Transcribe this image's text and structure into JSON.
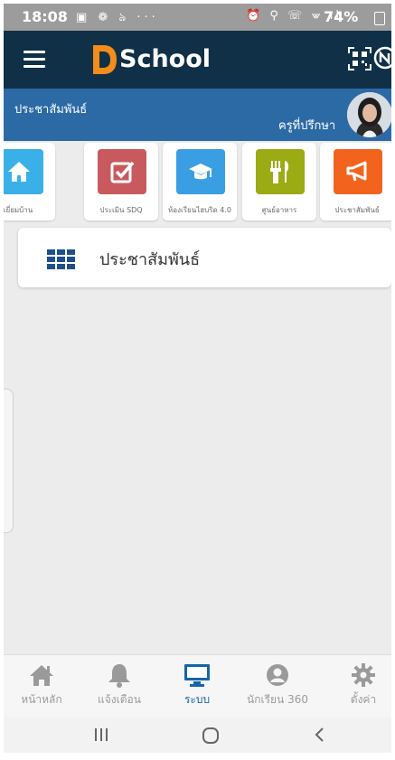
{
  "status_bar": {
    "time": "18:08",
    "left_icons": "▣ ❁ ঌ ···",
    "right_icons": "⏰ ⚲ ☏ ⩖ ıl",
    "battery_percent": "74%"
  },
  "app_bar": {
    "logo_letter": "D",
    "logo_text": "School",
    "menu_icon": "hamburger-icon",
    "qr_icon": "qr-scan-icon",
    "extra_icon": "circle-n-icon"
  },
  "profile": {
    "left_label": "ประชาสัมพันธ์",
    "right_label": "ครูที่ปรึกษา"
  },
  "menu_cards": [
    {
      "label": "เยี่ยมบ้าน",
      "icon": "home-icon",
      "color": "#3ab0e8"
    },
    {
      "label": "ประเมิน SDQ",
      "icon": "checkbox-icon",
      "color": "#c85a5f"
    },
    {
      "label": "ห้องเรียนไฮบริด 4.0",
      "icon": "graduation-cap-icon",
      "color": "#3a9ee3"
    },
    {
      "label": "ศูนย์อาหาร",
      "icon": "utensils-icon",
      "color": "#9bab14"
    },
    {
      "label": "ประชาสัมพันธ์",
      "icon": "megaphone-icon",
      "color": "#f2641e"
    }
  ],
  "section": {
    "title": "ประชาสัมพันธ์",
    "icon": "grid-icon"
  },
  "bottom_nav": [
    {
      "label": "หน้าหลัก",
      "icon": "home-icon",
      "active": false
    },
    {
      "label": "แจ้งเตือน",
      "icon": "bell-icon",
      "active": false
    },
    {
      "label": "ระบบ",
      "icon": "monitor-icon",
      "active": true
    },
    {
      "label": "นักเรียน 360",
      "icon": "user-circle-icon",
      "active": false
    },
    {
      "label": "ตั้งค่า",
      "icon": "gear-icon",
      "active": false
    }
  ],
  "colors": {
    "app_bar": "#0f3046",
    "profile_bar": "#2c6aa6",
    "logo_orange": "#f28c1a",
    "active_nav": "#1565a8"
  }
}
